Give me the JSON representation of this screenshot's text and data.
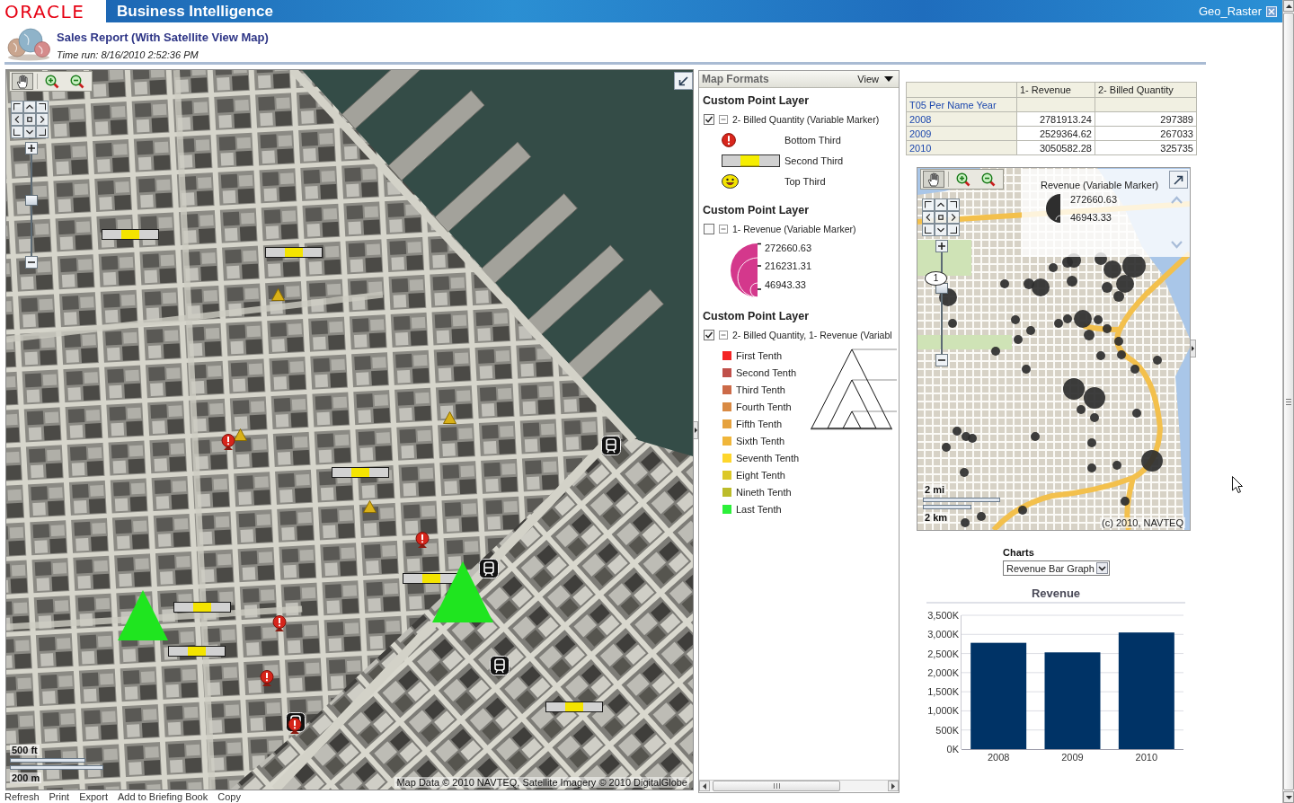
{
  "header": {
    "logo": "ORACLE",
    "product": "Business Intelligence",
    "dashboard": "Geo_Raster"
  },
  "report": {
    "title": "Sales Report (With Satellite View Map)",
    "time_run": "Time run: 8/16/2010 2:52:36 PM"
  },
  "satellite_map": {
    "tools": [
      {
        "kind": "pan",
        "selected": true
      },
      {
        "kind": "zoom_in",
        "selected": false
      },
      {
        "kind": "zoom_out",
        "selected": false
      }
    ],
    "zoom": {
      "level": 0.55
    },
    "scale": [
      "500 ft",
      "200 m"
    ],
    "attribution": "Map Data © 2010 NAVTEQ, Satellite Imagery © 2010 DigitalGlobe"
  },
  "map_formats": {
    "title": "Map Formats",
    "view_menu": "View",
    "layers": [
      {
        "kind": "thirds",
        "heading": "Custom Point Layer",
        "checked": true,
        "expanded": true,
        "name": "2- Billed Quantity (Variable Marker)",
        "items": [
          {
            "kind": "alert",
            "label": "Bottom Third"
          },
          {
            "kind": "bar",
            "label": "Second Third"
          },
          {
            "kind": "smiley",
            "label": "Top Third"
          }
        ]
      },
      {
        "kind": "size",
        "heading": "Custom Point Layer",
        "checked": false,
        "expanded": true,
        "name": "1- Revenue (Variable Marker)",
        "values": [
          "272660.63",
          "216231.31",
          "46943.33"
        ]
      },
      {
        "kind": "tenths",
        "heading": "Custom Point Layer",
        "checked": true,
        "expanded": true,
        "name": "2- Billed Quantity, 1- Revenue (Variabl",
        "items": [
          {
            "label": "First Tenth",
            "color": "#f42424"
          },
          {
            "label": "Second Tenth",
            "color": "#c0504a"
          },
          {
            "label": "Third Tenth",
            "color": "#cc6a48"
          },
          {
            "label": "Fourth Tenth",
            "color": "#d98a44"
          },
          {
            "label": "Fifth Tenth",
            "color": "#e6a23e"
          },
          {
            "label": "Sixth Tenth",
            "color": "#f0b63a"
          },
          {
            "label": "Seventh Tenth",
            "color": "#fed62c"
          },
          {
            "label": "Eight Tenth",
            "color": "#dcc828"
          },
          {
            "label": "Nineth Tenth",
            "color": "#bcbc2a"
          },
          {
            "label": "Last Tenth",
            "color": "#2cf03a"
          }
        ]
      }
    ]
  },
  "summary_table": {
    "columns": [
      "1- Revenue",
      "2- Billed Quantity"
    ],
    "row_header": "T05 Per Name Year",
    "rows": [
      {
        "year": "2008",
        "revenue": "2781913.24",
        "billed_quantity": "297389"
      },
      {
        "year": "2009",
        "revenue": "2529364.62",
        "billed_quantity": "267033"
      },
      {
        "year": "2010",
        "revenue": "3050582.28",
        "billed_quantity": "325735"
      }
    ]
  },
  "overview_map": {
    "tools": [
      {
        "kind": "pan",
        "selected": true
      },
      {
        "kind": "zoom_in",
        "selected": false
      },
      {
        "kind": "zoom_out",
        "selected": false
      }
    ],
    "zoom": {
      "level": 0.66,
      "label": "1"
    },
    "legend": {
      "title": "Revenue (Variable Marker)",
      "values": [
        "272660.63",
        "46943.33"
      ]
    },
    "scale": [
      "2 mi",
      "2 km"
    ],
    "copyright": "(c) 2010, NAVTEQ"
  },
  "charts": {
    "label": "Charts",
    "selector": "Revenue Bar Graph",
    "chart_data": {
      "type": "bar",
      "title": "Revenue",
      "categories": [
        "2008",
        "2009",
        "2010"
      ],
      "series": [
        {
          "color": "#003366",
          "values": [
            2780000,
            2530000,
            3050000
          ]
        }
      ],
      "ylim": [
        0,
        3500000
      ],
      "grid": true,
      "yticks": [
        {
          "value": 0,
          "label": "0K"
        },
        {
          "value": 500000,
          "label": "500K"
        },
        {
          "value": 1000000,
          "label": "1,000K"
        },
        {
          "value": 1500000,
          "label": "1,500K"
        },
        {
          "value": 2000000,
          "label": "2,000K"
        },
        {
          "value": 2500000,
          "label": "2,500K"
        },
        {
          "value": 3000000,
          "label": "3,000K"
        },
        {
          "value": 3500000,
          "label": "3,500K"
        }
      ]
    }
  },
  "footer_links": [
    "Refresh",
    "Print",
    "Export",
    "Add to Briefing Book",
    "Copy"
  ]
}
